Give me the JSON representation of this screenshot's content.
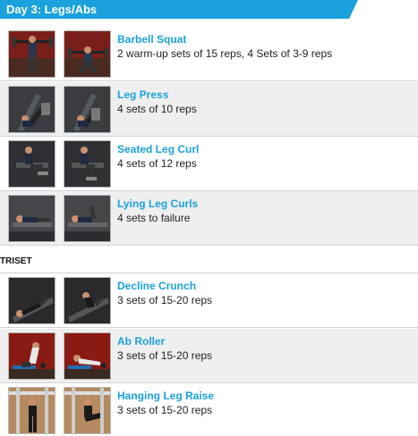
{
  "header": {
    "title": "Day 3: Legs/Abs"
  },
  "exercises": [
    {
      "name": "Barbell Squat",
      "detail": "2 warm-up sets of 15 reps, 4 Sets of 3-9 reps"
    },
    {
      "name": "Leg Press",
      "detail": "4 sets of 10 reps"
    },
    {
      "name": "Seated Leg Curl",
      "detail": "4 sets of 12 reps"
    },
    {
      "name": "Lying Leg Curls",
      "detail": "4 sets to failure"
    }
  ],
  "triset": {
    "label": "TRISET",
    "exercises": [
      {
        "name": "Decline Crunch",
        "detail": "3 sets of 15-20 reps"
      },
      {
        "name": "Ab Roller",
        "detail": "3 sets of 15-20 reps"
      },
      {
        "name": "Hanging Leg Raise",
        "detail": "3 sets of 15-20 reps"
      }
    ]
  },
  "colors": {
    "accent": "#1ba1dc",
    "row_alt": "#efefef",
    "divider": "#d4d4d4"
  }
}
